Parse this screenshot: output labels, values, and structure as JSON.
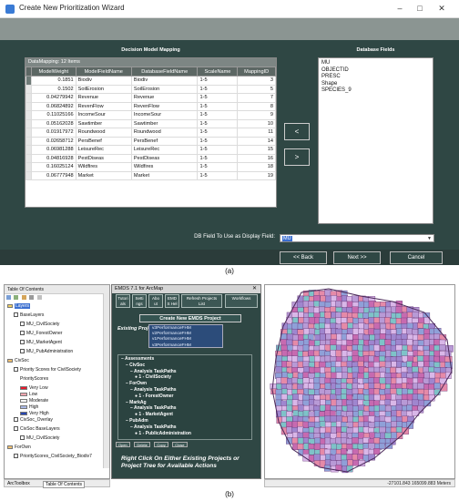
{
  "panel_a": {
    "window_title": "Create New Prioritization Wizard",
    "window_buttons": [
      "–",
      "□",
      "✕"
    ],
    "decision_model_title": "Decision Model Mapping",
    "database_fields_title": "Database Fields",
    "table_header": "DataMapping: 12 Items",
    "columns": [
      "ModelWeight",
      "ModelFieldName",
      "DatabaseFieldName",
      "ScaleName",
      "MappingID"
    ],
    "rows": [
      [
        "0.1851",
        "Biodiv",
        "Biodiv",
        "1-5",
        "3"
      ],
      [
        "0.1502",
        "SoilErosion",
        "SoilErosion",
        "1-5",
        "5"
      ],
      [
        "0.04279942",
        "Revenue",
        "Revenue",
        "1-5",
        "7"
      ],
      [
        "0.06824892",
        "RevenFlow",
        "RevenFlow",
        "1-5",
        "8"
      ],
      [
        "0.11025166",
        "IncomeSour",
        "IncomeSour",
        "1-5",
        "9"
      ],
      [
        "0.05162028",
        "Sawtimber",
        "Sawtimber",
        "1-5",
        "10"
      ],
      [
        "0.01917972",
        "Roundwood",
        "Roundwood",
        "1-5",
        "11"
      ],
      [
        "0.02658712",
        "PersBenef",
        "PersBenef",
        "1-5",
        "14"
      ],
      [
        "0.06981288",
        "LeisureRec",
        "LeisureRec",
        "1-5",
        "15"
      ],
      [
        "0.04816928",
        "PestDiseas",
        "PestDiseas",
        "1-5",
        "16"
      ],
      [
        "0.16025124",
        "Wildfires",
        "Wildfires",
        "1-5",
        "18"
      ],
      [
        "0.06777948",
        "Market",
        "Market",
        "1-5",
        "19"
      ]
    ],
    "database_fields": [
      "MU",
      "OBJECTID",
      "PRESC",
      "Shape",
      "SPECIES_9"
    ],
    "move_left_label": "<",
    "move_right_label": ">",
    "display_field_label": "DB Field To Use as Display Field:",
    "display_field_value": "MU",
    "back_label": "<< Back",
    "next_label": "Next >>",
    "cancel_label": "Cancel",
    "caption": "(a)"
  },
  "panel_b": {
    "toc_title": "Table Of Contents",
    "toc_items": [
      {
        "text": "Layers",
        "level": 0,
        "kind": "root"
      },
      {
        "text": "BaseLayers",
        "level": 1,
        "kind": "check"
      },
      {
        "text": "MU_CivilSociety",
        "level": 2,
        "kind": "check"
      },
      {
        "text": "MU_ForestOwner",
        "level": 2,
        "kind": "check"
      },
      {
        "text": "MU_MarketAgent",
        "level": 2,
        "kind": "check"
      },
      {
        "text": "MU_PubAdministration",
        "level": 2,
        "kind": "check"
      },
      {
        "text": "CivSoc",
        "level": 0,
        "kind": "group"
      },
      {
        "text": "Priority Scores for CivilSociety",
        "level": 1,
        "kind": "check"
      },
      {
        "text": "PriorityScores",
        "level": 2,
        "kind": "text"
      },
      {
        "text": "Very Low",
        "level": 2,
        "kind": "legend",
        "color": "#e8192c"
      },
      {
        "text": "Low",
        "level": 2,
        "kind": "legend",
        "color": "#f5a6b0"
      },
      {
        "text": "Moderate",
        "level": 2,
        "kind": "legend",
        "color": "#ffffff"
      },
      {
        "text": "High",
        "level": 2,
        "kind": "legend",
        "color": "#a9b8e6"
      },
      {
        "text": "Very High",
        "level": 2,
        "kind": "legend",
        "color": "#2746b0"
      },
      {
        "text": "CivSoc_Overlay",
        "level": 1,
        "kind": "check"
      },
      {
        "text": "CivSoc BaseLayers",
        "level": 1,
        "kind": "check"
      },
      {
        "text": "MU_CivilSociety",
        "level": 2,
        "kind": "check"
      },
      {
        "text": "ForOwn",
        "level": 0,
        "kind": "group"
      },
      {
        "text": "PriorityScores_CivilSociety_Biodiv7",
        "level": 1,
        "kind": "check"
      }
    ],
    "toc_tabs": [
      "ArcToolbox",
      "Table Of Contents"
    ],
    "emds_title": "EMDS 7.1 for ArcMap",
    "emds_toolbar": [
      {
        "l1": "Tutori",
        "l2": "als"
      },
      {
        "l1": "Setti",
        "l2": "ngs"
      },
      {
        "l1": "Abo",
        "l2": "ut"
      },
      {
        "l1": "EMD",
        "l2": "S Hel"
      },
      {
        "l1": "Refresh Projects",
        "l2": "List"
      },
      {
        "l1": "Workflows",
        "l2": ""
      }
    ],
    "create_project_label": "Create New EMDS Project",
    "existing_projects_label": "Existing Projects:",
    "existing_projects": [
      "v3PerformanceFHM",
      "v2PerformanceFHM",
      "v1PerformanceFHM",
      "v3PerformanceFHM"
    ],
    "assessments_tree": [
      {
        "text": "Assessments",
        "level": 0,
        "bold": true
      },
      {
        "text": "CivSoc",
        "level": 1,
        "bold": true
      },
      {
        "text": "Analysis TaskPaths",
        "level": 2,
        "bold": true
      },
      {
        "text": "1 - CivilSociety",
        "level": 3,
        "bold": true
      },
      {
        "text": "ForOwn",
        "level": 1,
        "bold": true
      },
      {
        "text": "Analysis TaskPaths",
        "level": 2,
        "bold": true
      },
      {
        "text": "1 - ForestOwner",
        "level": 3,
        "bold": true
      },
      {
        "text": "MarkAg",
        "level": 1,
        "bold": true
      },
      {
        "text": "Analysis TaskPaths",
        "level": 2,
        "bold": true
      },
      {
        "text": "1 - MarketAgent",
        "level": 3,
        "bold": true
      },
      {
        "text": "PubAdm",
        "level": 1,
        "bold": true
      },
      {
        "text": "Analysis TaskPaths",
        "level": 2,
        "bold": true
      },
      {
        "text": "1 - PublicAdministration",
        "level": 3,
        "bold": true
      }
    ],
    "bottom_buttons": [
      "Open",
      "Delete",
      "Copy",
      "Close"
    ],
    "instructions": "Right Click On Either Existing Projects or Project Tree for Available Actions",
    "map_coords": "-27101.843  165099.883 Meters",
    "map_colors": [
      "#b89ad6",
      "#9f86cf",
      "#7ec3c8",
      "#e58aa8",
      "#c76ab0",
      "#8fa0d8",
      "#d9b7e8"
    ],
    "caption": "(b)"
  }
}
